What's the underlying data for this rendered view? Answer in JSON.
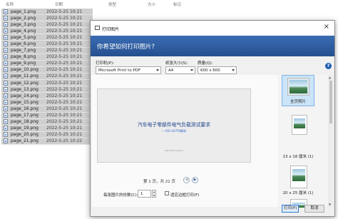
{
  "explorer": {
    "columns": {
      "name": "名称",
      "date": "日期",
      "type": "类型",
      "size": "大小",
      "tags": "标记"
    },
    "files": [
      {
        "name": "page_1.png",
        "date": "2022-5-25 10:21"
      },
      {
        "name": "page_2.png",
        "date": "2022-5-25 10:21"
      },
      {
        "name": "page_3.png",
        "date": "2022-5-25 10:21"
      },
      {
        "name": "page_4.png",
        "date": "2022-5-25 10:21"
      },
      {
        "name": "page_5.png",
        "date": "2022-5-25 10:21"
      },
      {
        "name": "page_6.png",
        "date": "2022-5-25 10:21"
      },
      {
        "name": "page_7.png",
        "date": "2022-5-25 10:21"
      },
      {
        "name": "page_8.png",
        "date": "2022-5-25 10:21"
      },
      {
        "name": "page_9.png",
        "date": "2022-5-25 10:21"
      },
      {
        "name": "page_10.png",
        "date": "2022-5-25 10:21"
      },
      {
        "name": "page_11.png",
        "date": "2022-5-25 10:21"
      },
      {
        "name": "page_12.png",
        "date": "2022-5-25 10:21"
      },
      {
        "name": "page_13.png",
        "date": "2022-5-25 10:21"
      },
      {
        "name": "page_14.png",
        "date": "2022-5-25 10:21"
      },
      {
        "name": "page_15.png",
        "date": "2022-5-25 10:21"
      },
      {
        "name": "page_16.png",
        "date": "2022-5-25 10:21"
      },
      {
        "name": "page_17.png",
        "date": "2022-5-25 10:21"
      },
      {
        "name": "page_18.png",
        "date": "2022-5-25 10:21"
      },
      {
        "name": "page_19.png",
        "date": "2022-5-25 10:21"
      },
      {
        "name": "page_20.png",
        "date": "2022-5-25 10:21"
      },
      {
        "name": "page_21.png",
        "date": "2022-5-25 10:22"
      }
    ]
  },
  "dialog": {
    "title": "打印图片",
    "heading": "你希望如何打印图片?",
    "printer_label": "打印机(P):",
    "printer_value": "Microsoft Print to PDF",
    "paper_size_label": "纸张大小(S):",
    "paper_size_value": "A4",
    "quality_label": "质量(Q):",
    "quality_value": "600 x 600",
    "preview": {
      "doc_title": "汽车电子零部件电气负载测试要求",
      "doc_subtitle": "— ISO-16750解析",
      "doc_date": "2019.6.21  by.xxx"
    },
    "pager_text": "第 1 页，共 21 页",
    "layouts": [
      {
        "label": "全页照片"
      },
      {
        "label": "13 x 18 厘米 (1)"
      },
      {
        "label": "20 x 25 厘米 (1)"
      }
    ],
    "copies_label": "每张图片的份数(C):",
    "copies_value": "1",
    "fit_label": "适应边框打印(F)",
    "print_button": "打印(P)",
    "cancel_button": "取消",
    "colors": {
      "banner": "#2b5797",
      "accent": "#1f5fb0"
    }
  }
}
